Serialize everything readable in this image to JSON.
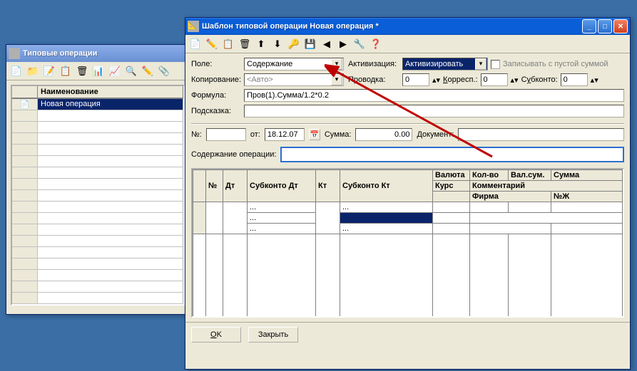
{
  "backWindow": {
    "title": "Типовые операции",
    "columns": {
      "icon": "",
      "name": "Наименование"
    },
    "rows": [
      {
        "name": "Новая операция"
      }
    ]
  },
  "mainWindow": {
    "title": "Шаблон типовой операции Новая операция *",
    "form": {
      "field_label": "Поле:",
      "field_value": "Содержание",
      "activation_label": "Активизация:",
      "activation_value": "Активизировать",
      "write_empty_label": "Записывать с пустой суммой",
      "copy_label": "Копирование:",
      "copy_value": "<Авто>",
      "posting_label": "Проводка:",
      "posting_value": "0",
      "corresp_label": "Корресп.:",
      "corresp_value": "0",
      "subconto_label": "Субконто:",
      "subconto_value": "0",
      "formula_label": "Формула:",
      "formula_value": "Пров(1).Сумма/1.2*0.2",
      "hint_label": "Подсказка:",
      "hint_value": ""
    },
    "row2": {
      "no_label": "№:",
      "no_value": "",
      "from_label": "от:",
      "date_value": "18.12.07",
      "sum_label": "Сумма:",
      "sum_value": "0.00",
      "doc_label": "Документ:",
      "doc_value": ""
    },
    "content_label": "Содержание операции:",
    "content_value": "",
    "grid": {
      "headers": {
        "idx": "",
        "no": "№",
        "dt": "Дт",
        "sub_dt": "Субконто Дт",
        "kt": "Кт",
        "sub_kt": "Субконто Кт",
        "currency": "Валюта",
        "rate": "Курс",
        "qty": "Кол-во",
        "valsum": "Вал.сум.",
        "sum": "Сумма",
        "comment": "Комментарий",
        "firm": "Фирма",
        "nj": "№Ж"
      },
      "placeholder": "..."
    },
    "buttons": {
      "ok": "OK",
      "close": "Закрыть"
    }
  }
}
